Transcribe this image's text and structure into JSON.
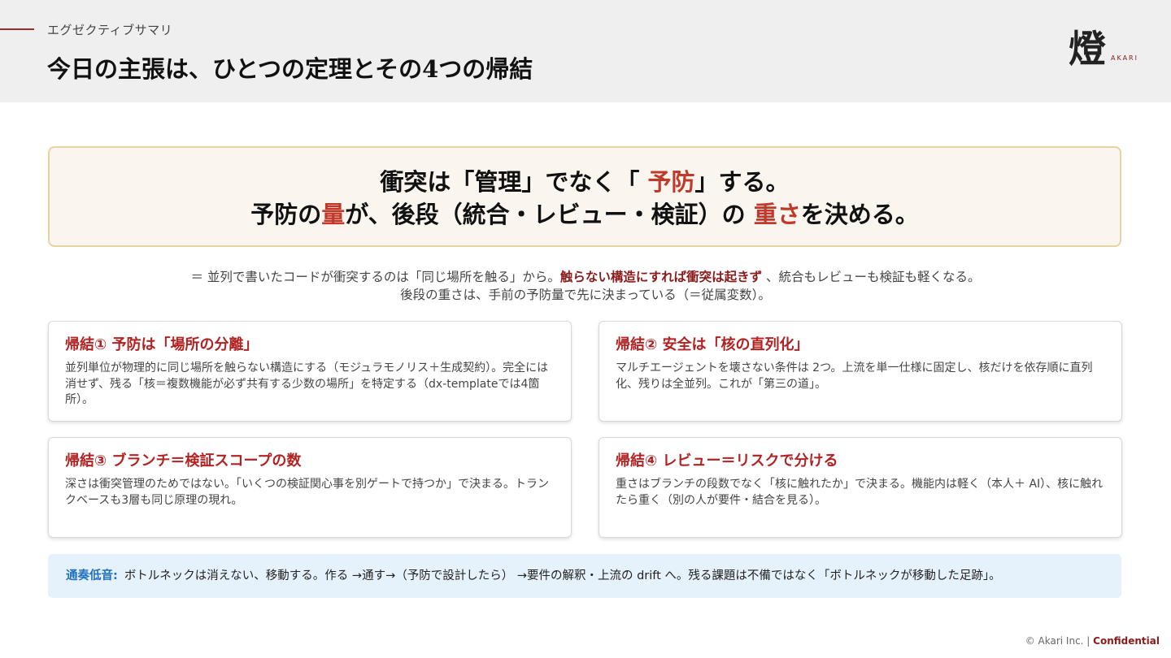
{
  "header": {
    "section_label": "エグゼクティブサマリ",
    "title": "今日の主張は、ひとつの定理とその4つの帰結",
    "logo_mark": "燈",
    "logo_text": "AKARI"
  },
  "thesis": {
    "line1_a": "衝突は「管理」でなく「 ",
    "line1_accent": "予防",
    "line1_b": "」する。",
    "line2_a": "予防の",
    "line2_accent1": "量",
    "line2_b": "が、後段（統合・レビュー・検証）の ",
    "line2_accent2": "重さ",
    "line2_c": "を決める。"
  },
  "explain": {
    "line1_a": "＝ 並列で書いたコードが衝突するのは「同じ場所を触る」から。",
    "line1_strong": "触らない構造にすれば衝突は起きず",
    "line1_b": " 、統合もレビューも検証も軽くなる。",
    "line2": "後段の重さは、手前の予防量で先に決まっている（＝従属変数）。"
  },
  "cards": [
    {
      "title": "帰結① 予防は「場所の分離」",
      "body": "並列単位が物理的に同じ場所を触らない構造にする（モジュラモノリス＋生成契約）。完全には消せず、残る「核＝複数機能が必ず共有する少数の場所」を特定する（dx-templateでは4箇所）。"
    },
    {
      "title": "帰結② 安全は「核の直列化」",
      "body": "マルチエージェントを壊さない条件は 2つ。上流を単一仕様に固定し、核だけを依存順に直列化、残りは全並列。これが「第三の道」。"
    },
    {
      "title": "帰結③ ブランチ＝検証スコープの数",
      "body": "深さは衝突管理のためではない。「いくつの検証関心事を別ゲートで持つか」で決まる。トランクベースも3層も同じ原理の現れ。"
    },
    {
      "title": "帰結④ レビュー＝リスクで分ける",
      "body": "重さはブランチの段数でなく「核に触れたか」で決まる。機能内は軽く（本人＋ AI）、核に触れたら重く（別の人が要件・結合を見る）。"
    }
  ],
  "note": {
    "label": "通奏低音:",
    "text": "ボトルネックは消えない、移動する。作る →通す→（予防で設計したら） →要件の解釈・上流の drift へ。残る課題は不備ではなく「ボトルネックが移動した足跡」。"
  },
  "footer": {
    "copyright": "© Akari Inc. | ",
    "confidential": "Confidential"
  },
  "colors": {
    "accent": "#c0392b",
    "card_title": "#b22222",
    "note_label": "#1f6fc4",
    "thesis_border": "#e8d3a0"
  }
}
